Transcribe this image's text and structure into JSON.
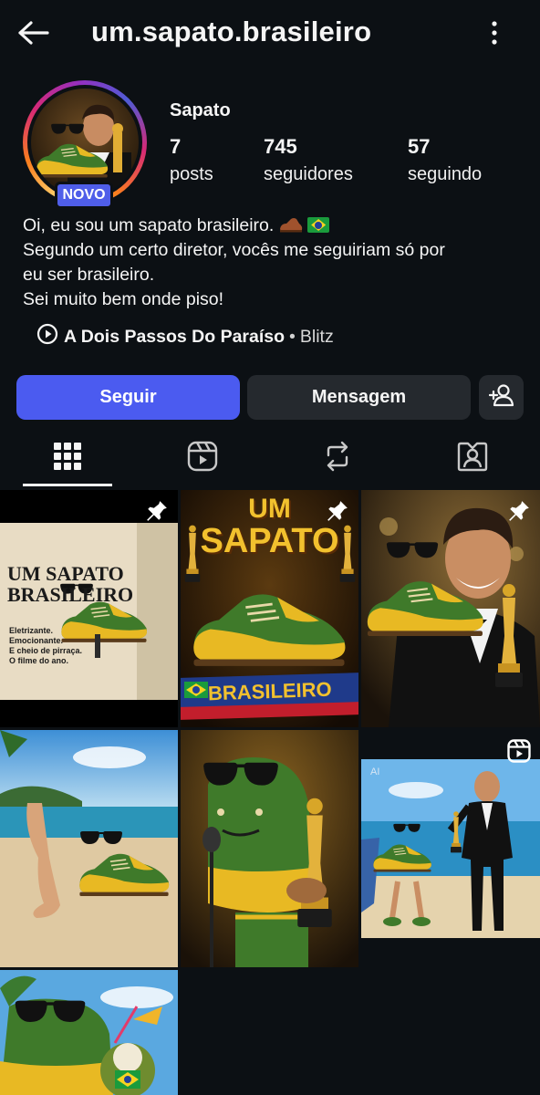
{
  "header": {
    "username": "um.sapato.brasileiro",
    "back_icon": "back-arrow-icon",
    "more_icon": "more-vertical-icon"
  },
  "profile": {
    "display_name": "Sapato",
    "new_badge": "NOVO",
    "stats": [
      {
        "value": "7",
        "label": "posts"
      },
      {
        "value": "745",
        "label": "seguidores"
      },
      {
        "value": "57",
        "label": "seguindo"
      }
    ],
    "bio": [
      "Oi, eu sou um sapato brasileiro. ",
      "Segundo um certo diretor, vocês me seguiriam só por",
      "eu ser brasileiro.",
      "Sei muito bem onde piso!"
    ],
    "music": {
      "song": "A Dois Passos Do Paraíso",
      "separator": "•",
      "artist": "Blitz"
    }
  },
  "actions": {
    "follow_label": "Seguir",
    "message_label": "Mensagem",
    "add_user_icon": "add-user-icon"
  },
  "tabs": [
    "grid-icon",
    "reels-icon",
    "reposts-icon",
    "tagged-icon"
  ],
  "posts": [
    {
      "pinned": true,
      "title_lines": [
        "UM SAPATO",
        "BRASILEIRO"
      ],
      "tagline": [
        "Eletrizante.",
        "Emocionante.",
        "E cheio de pirraça.",
        "O filme do ano."
      ]
    },
    {
      "pinned": true,
      "title_lines": [
        "UM",
        "SAPATO"
      ],
      "banner": "BRASILEIRO"
    },
    {
      "pinned": true
    },
    {
      "pinned": false
    },
    {
      "pinned": false
    },
    {
      "pinned": false,
      "reel": true,
      "ai_label": "AI"
    },
    {
      "pinned": false
    }
  ],
  "colors": {
    "background": "#0c1014",
    "follow_button": "#4b5bf0",
    "secondary_button": "#25292e",
    "badge": "#4f5ee9",
    "shoe_green": "#3f7a2a",
    "shoe_yellow": "#e8b923"
  }
}
